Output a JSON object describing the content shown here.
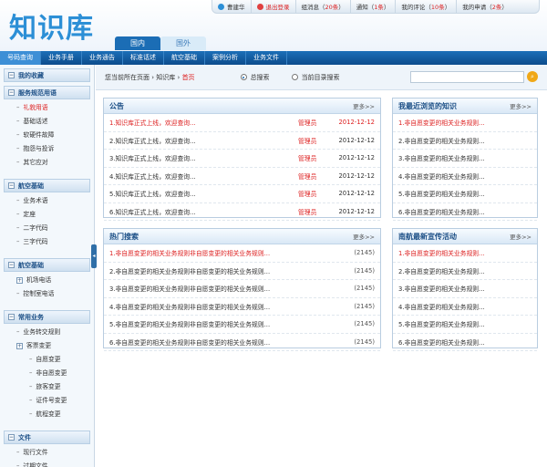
{
  "logo": "知识库",
  "userbar": [
    {
      "label": "曹建华",
      "count": "",
      "color": "#2c8fd6"
    },
    {
      "label": "退出登录",
      "count": "",
      "color": "#e04040"
    },
    {
      "label": "组消息（",
      "count": "20条",
      "suffix": "）",
      "color": ""
    },
    {
      "label": "通知（",
      "count": "1条",
      "suffix": "）",
      "color": ""
    },
    {
      "label": "我的评论（",
      "count": "10条",
      "suffix": "）",
      "color": ""
    },
    {
      "label": "我的申请（",
      "count": "2条",
      "suffix": "）",
      "color": ""
    }
  ],
  "tabs": [
    {
      "label": "国内"
    },
    {
      "label": "国外"
    }
  ],
  "nav": [
    "号码查询",
    "业务手册",
    "业务通告",
    "标准话述",
    "航空基础",
    "案例分析",
    "业务文件"
  ],
  "sidebar": [
    {
      "title": "我的收藏",
      "items": []
    },
    {
      "title": "服务规范用语",
      "items": [
        {
          "label": "礼貌用语",
          "sel": true
        },
        {
          "label": "基础话述"
        },
        {
          "label": "软硬件故障"
        },
        {
          "label": "抱怨与投诉"
        },
        {
          "label": "其它应对"
        }
      ]
    },
    {
      "title": "航空基础",
      "items": [
        {
          "label": "业务术语"
        },
        {
          "label": "定座"
        },
        {
          "label": "二字代码"
        },
        {
          "label": "三字代码"
        }
      ]
    },
    {
      "title": "航空基础",
      "items": [
        {
          "label": "机场电话",
          "box": true
        },
        {
          "label": "控制室电话"
        }
      ]
    },
    {
      "title": "常用业务",
      "items": [
        {
          "label": "业务转交规则"
        },
        {
          "label": "客票变更",
          "box": true
        },
        {
          "label": "自愿变更",
          "sub": true
        },
        {
          "label": "非自愿变更",
          "sub": true
        },
        {
          "label": "旅客变更",
          "sub": true
        },
        {
          "label": "证件号变更",
          "sub": true
        },
        {
          "label": "航程变更",
          "sub": true
        }
      ]
    },
    {
      "title": "文件",
      "items": [
        {
          "label": "现行文件"
        },
        {
          "label": "过期文件"
        }
      ]
    }
  ],
  "breadcrumb": {
    "prefix": "您当前所在页面",
    "middle": "知识库",
    "sep": "›",
    "home": "首页"
  },
  "radios": [
    {
      "label": "总搜索",
      "on": true
    },
    {
      "label": "当前目录搜索",
      "on": false
    }
  ],
  "more": "更多>>",
  "notice": {
    "title": "公告",
    "rows": [
      {
        "num": "1.",
        "text": "知识库正式上线，欢迎查询...",
        "author": "管理员",
        "date": "2012-12-12",
        "red": true
      },
      {
        "num": "2.",
        "text": "知识库正式上线，欢迎查询...",
        "author": "管理员",
        "date": "2012-12-12"
      },
      {
        "num": "3.",
        "text": "知识库正式上线，欢迎查询...",
        "author": "管理员",
        "date": "2012-12-12"
      },
      {
        "num": "4.",
        "text": "知识库正式上线，欢迎查询...",
        "author": "管理员",
        "date": "2012-12-12"
      },
      {
        "num": "5.",
        "text": "知识库正式上线，欢迎查询...",
        "author": "管理员",
        "date": "2012-12-12"
      },
      {
        "num": "6.",
        "text": "知识库正式上线，欢迎查询...",
        "author": "管理员",
        "date": "2012-12-12"
      }
    ]
  },
  "recent": {
    "title": "我最近浏览的知识",
    "rows": [
      {
        "num": "1.",
        "text": "非自愿变更的相关业务规则...",
        "red": true
      },
      {
        "num": "2.",
        "text": "非自愿变更的相关业务规则..."
      },
      {
        "num": "3.",
        "text": "非自愿变更的相关业务规则..."
      },
      {
        "num": "4.",
        "text": "非自愿变更的相关业务规则..."
      },
      {
        "num": "5.",
        "text": "非自愿变更的相关业务规则..."
      },
      {
        "num": "6.",
        "text": "非自愿变更的相关业务规则..."
      }
    ]
  },
  "hot": {
    "title": "热门搜索",
    "rows": [
      {
        "num": "1.",
        "text": "非自愿变更的相关业务规则非自愿变更的相关业务规则...",
        "count": "(2145)",
        "red": true
      },
      {
        "num": "2.",
        "text": "非自愿变更的相关业务规则非自愿变更的相关业务规则...",
        "count": "(2145)"
      },
      {
        "num": "3.",
        "text": "非自愿变更的相关业务规则非自愿变更的相关业务规则...",
        "count": "(2145)"
      },
      {
        "num": "4.",
        "text": "非自愿变更的相关业务规则非自愿变更的相关业务规则...",
        "count": "(2145)"
      },
      {
        "num": "5.",
        "text": "非自愿变更的相关业务规则非自愿变更的相关业务规则...",
        "count": "(2145)"
      },
      {
        "num": "6.",
        "text": "非自愿变更的相关业务规则非自愿变更的相关业务规则...",
        "count": "(2145)"
      }
    ]
  },
  "promo": {
    "title": "南航最新宣传活动",
    "rows": [
      {
        "num": "1.",
        "text": "非自愿变更的相关业务规则...",
        "red": true
      },
      {
        "num": "2.",
        "text": "非自愿变更的相关业务规则..."
      },
      {
        "num": "3.",
        "text": "非自愿变更的相关业务规则..."
      },
      {
        "num": "4.",
        "text": "非自愿变更的相关业务规则..."
      },
      {
        "num": "5.",
        "text": "非自愿变更的相关业务规则..."
      },
      {
        "num": "6.",
        "text": "非自愿变更的相关业务规则..."
      }
    ]
  }
}
